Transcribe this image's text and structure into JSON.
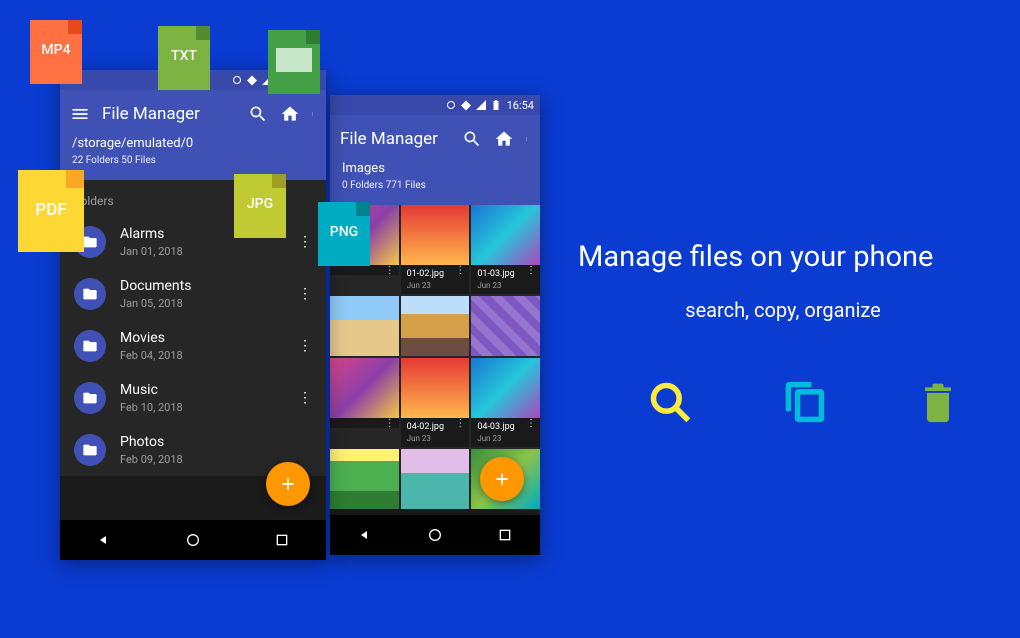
{
  "status_time": "16:54",
  "app_title": "File Manager",
  "phone1": {
    "breadcrumb": "/storage/emulated/0",
    "stats": "22 Folders 50 Files",
    "section": "Folders",
    "folders": [
      {
        "name": "Alarms",
        "date": "Jan 01, 2018"
      },
      {
        "name": "Documents",
        "date": "Jan 05, 2018"
      },
      {
        "name": "Movies",
        "date": "Feb 04, 2018"
      },
      {
        "name": "Music",
        "date": "Feb 10, 2018"
      },
      {
        "name": "Photos",
        "date": "Feb 09, 2018"
      }
    ]
  },
  "phone2": {
    "breadcrumb": "Images",
    "stats": "0 Folders 771 Files",
    "images": [
      {
        "name": "",
        "date": ""
      },
      {
        "name": "01-02.jpg",
        "date": "Jun 23"
      },
      {
        "name": "01-03.jpg",
        "date": "Jun 23"
      },
      {
        "name": "",
        "date": ""
      },
      {
        "name": "04-02.jpg",
        "date": "Jun 23"
      },
      {
        "name": "04-03.jpg",
        "date": "Jun 23"
      }
    ]
  },
  "badges": {
    "mp4": "MP4",
    "txt": "TXT",
    "pdf": "PDF",
    "jpg": "JPG",
    "png": "PNG"
  },
  "hero": {
    "title": "Manage files on your phone",
    "subtitle": "search, copy, organize"
  }
}
